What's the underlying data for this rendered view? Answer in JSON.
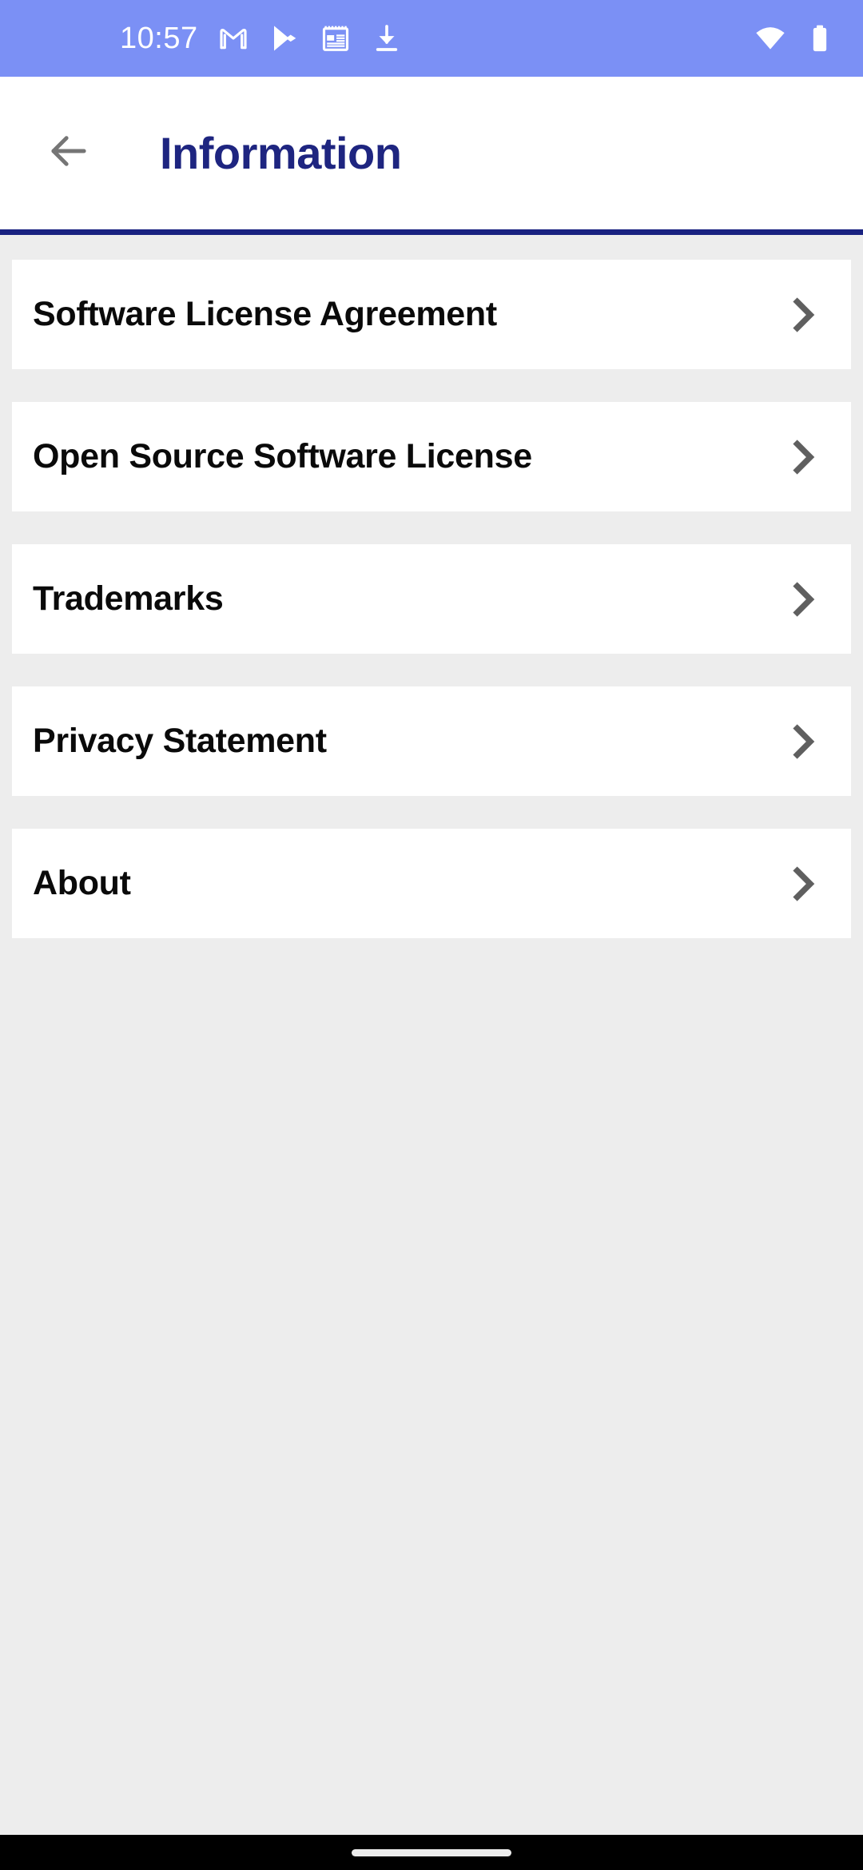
{
  "status_bar": {
    "time": "10:57",
    "background_color": "#7b90f5",
    "foreground_color": "#ffffff",
    "left_icons": [
      "gmail-icon",
      "play-store-icon",
      "news-icon",
      "download-icon"
    ],
    "right_icons": [
      "wifi-icon",
      "battery-icon"
    ]
  },
  "app_bar": {
    "title": "Information",
    "title_color": "#1e2580",
    "back_icon": "back-arrow-icon",
    "background_color": "#ffffff",
    "underline_color": "#192281"
  },
  "list": {
    "background_color": "#ededed",
    "card_color": "#ffffff",
    "chevron_icon": "chevron-right-icon",
    "chevron_color": "#5f5f5f",
    "items": [
      {
        "label": "Software License Agreement"
      },
      {
        "label": "Open Source Software License"
      },
      {
        "label": "Trademarks"
      },
      {
        "label": "Privacy Statement"
      },
      {
        "label": "About"
      }
    ]
  },
  "nav_bar": {
    "background_color": "#000000",
    "gesture_pill_color": "#ececec"
  }
}
